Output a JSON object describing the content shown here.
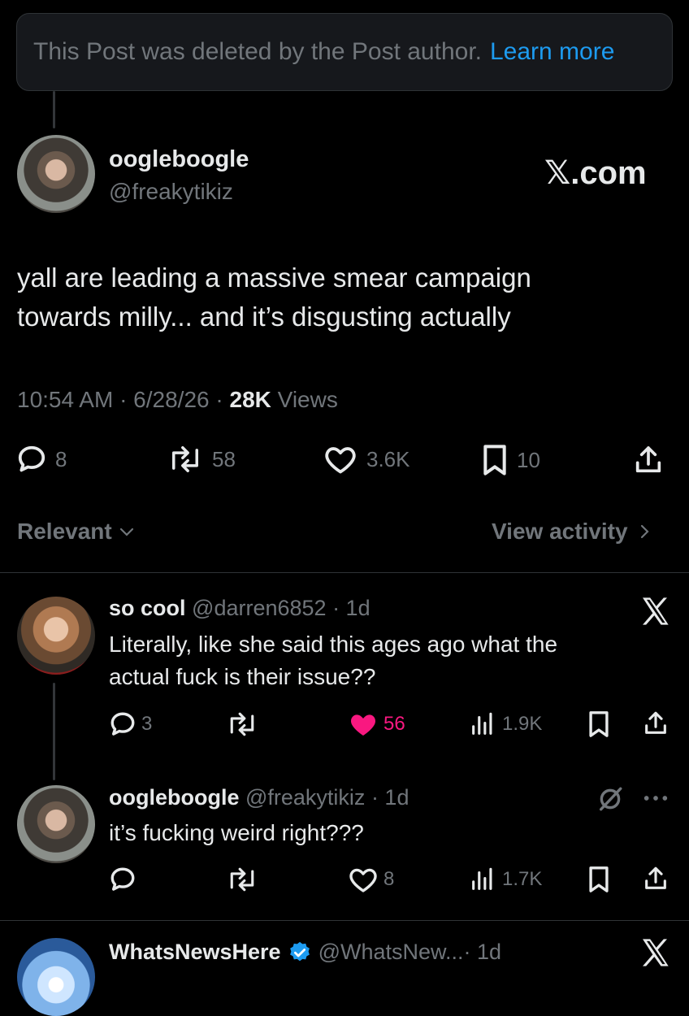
{
  "deleted_banner": {
    "text": "This Post was deleted by the Post author.",
    "link": "Learn more"
  },
  "watermark": "𝕏.com",
  "post": {
    "author_name": "oogleboogle",
    "author_handle": "@freakytikiz",
    "text_line1": "yall are leading a massive smear campaign",
    "text_line2": "towards milly... and it’s disgusting actually",
    "time": "10:54 AM · 6/28/26 · ",
    "views_count": "28K",
    "views_label": " Views",
    "replies": "8",
    "reposts": "58",
    "likes": "3.6K",
    "bookmarks": "10"
  },
  "sort": {
    "label": "Relevant",
    "view_activity": "View activity"
  },
  "replies": [
    {
      "name": "so cool",
      "handle": "@darren6852",
      "time": " · 1d",
      "text_line1": "Literally, like she said this ages ago what the",
      "text_line2": "actual fuck is their issue??",
      "replies": "3",
      "reposts": "",
      "likes": "56",
      "views": "1.9K",
      "liked": true,
      "badge_icon": "x-logo-icon"
    },
    {
      "name": "oogleboogle",
      "handle": "@freakytikiz",
      "time": " · 1d",
      "text_line1": "it’s fucking weird right???",
      "replies": "",
      "reposts": "",
      "likes": "8",
      "views": "1.7K",
      "liked": false,
      "badge_icon": "grok-icon"
    },
    {
      "name": "WhatsNewsHere",
      "handle": "@WhatsNew...",
      "time": " · 1d",
      "verified": true,
      "badge_icon": "x-logo-icon"
    }
  ],
  "colors": {
    "background": "#000000",
    "text": "#e7e9ea",
    "muted": "#71767b",
    "link": "#1d9bf0",
    "like": "#f91880",
    "verified": "#1d9bf0"
  }
}
